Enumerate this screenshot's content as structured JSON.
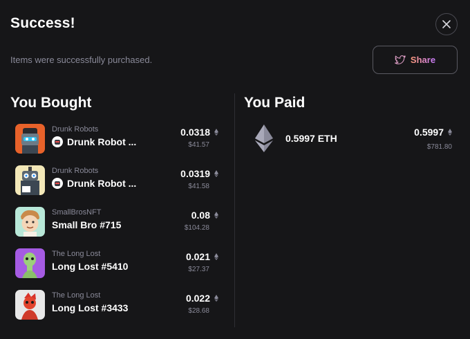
{
  "header": {
    "title": "Success!",
    "subtitle": "Items were successfully purchased.",
    "share_label": "Share"
  },
  "bought": {
    "heading": "You Bought",
    "items": [
      {
        "collection": "Drunk Robots",
        "name": "Drunk Robot ...",
        "price": "0.0318",
        "usd": "$41.57",
        "badge": true,
        "thumb_bg": "#e8622a"
      },
      {
        "collection": "Drunk Robots",
        "name": "Drunk Robot ...",
        "price": "0.0319",
        "usd": "$41.58",
        "badge": true,
        "thumb_bg": "#f3e8b8"
      },
      {
        "collection": "SmallBrosNFT",
        "name": "Small Bro #715",
        "price": "0.08",
        "usd": "$104.28",
        "badge": false,
        "thumb_bg": "#b8e8d8"
      },
      {
        "collection": "The Long Lost",
        "name": "Long Lost #5410",
        "price": "0.021",
        "usd": "$27.37",
        "badge": false,
        "thumb_bg": "#a55be3"
      },
      {
        "collection": "The Long Lost",
        "name": "Long Lost #3433",
        "price": "0.022",
        "usd": "$28.68",
        "badge": false,
        "thumb_bg": "#e8e8e8"
      }
    ]
  },
  "paid": {
    "heading": "You Paid",
    "amount_label": "0.5997 ETH",
    "price": "0.5997",
    "usd": "$781.80"
  },
  "colors": {
    "background": "#161618",
    "muted_text": "#8a8a99",
    "border": "#4a4a52",
    "share_gradient_start": "#ff9a7a",
    "share_gradient_end": "#c67bff"
  },
  "icons": {
    "close": "close-icon",
    "share": "twitter-bird-icon",
    "currency": "ethereum-icon"
  }
}
